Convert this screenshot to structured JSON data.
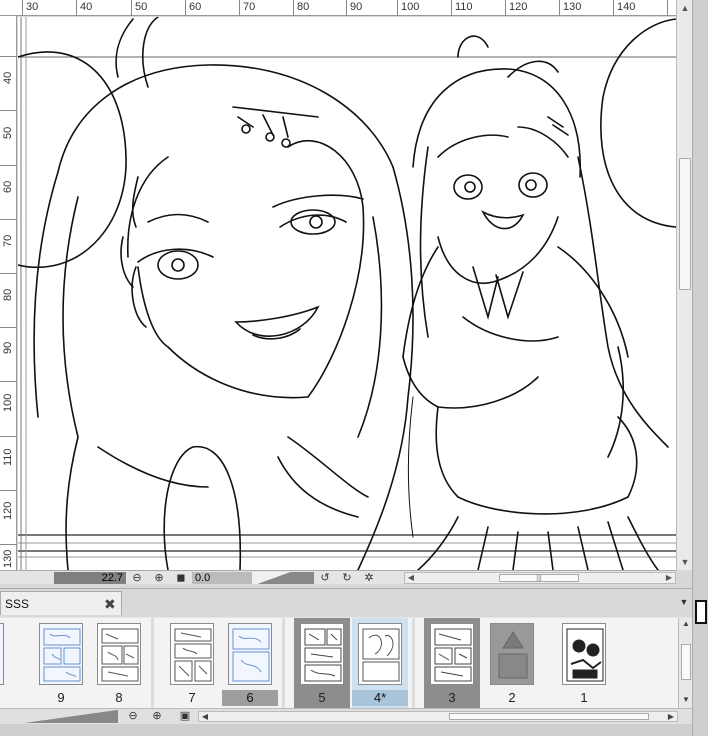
{
  "ruler": {
    "top_labels": [
      "30",
      "40",
      "50",
      "60",
      "70",
      "80",
      "90",
      "100",
      "110",
      "120",
      "130",
      "140"
    ],
    "left_labels": [
      "40",
      "50",
      "60",
      "70",
      "80",
      "90",
      "100",
      "110",
      "120",
      "130"
    ]
  },
  "canvas_status": {
    "zoom_value": "22.7",
    "angle_value": "0.0",
    "icons": [
      "zoom-out-icon",
      "zoom-in-icon",
      "fit-icon",
      "rotate-left-icon",
      "rotate-right-icon",
      "reset-rotation-icon"
    ]
  },
  "page_manager": {
    "tab_title": "SSS",
    "tab_close": "✖",
    "menu_glyph": "▼",
    "pages": [
      {
        "label": "9",
        "state": "normal",
        "style": "blue"
      },
      {
        "label": "8",
        "state": "normal",
        "style": "sketch"
      },
      {
        "label": "7",
        "state": "normal",
        "style": "sketch"
      },
      {
        "label": "6",
        "state": "selected-gray",
        "style": "blue"
      },
      {
        "label": "5",
        "state": "dark",
        "style": "sketch"
      },
      {
        "label": "4*",
        "state": "selected-blue",
        "style": "sketch"
      },
      {
        "label": "3",
        "state": "dark",
        "style": "sketch"
      },
      {
        "label": "2",
        "state": "normal",
        "style": "gray"
      },
      {
        "label": "1",
        "state": "normal",
        "style": "ink"
      }
    ]
  },
  "colors": {
    "canvas_bg": "#ffffff",
    "panel_bg": "#e6e6e6",
    "selected_blue": "#a9c3d8",
    "selected_gray": "#9e9e9e"
  }
}
